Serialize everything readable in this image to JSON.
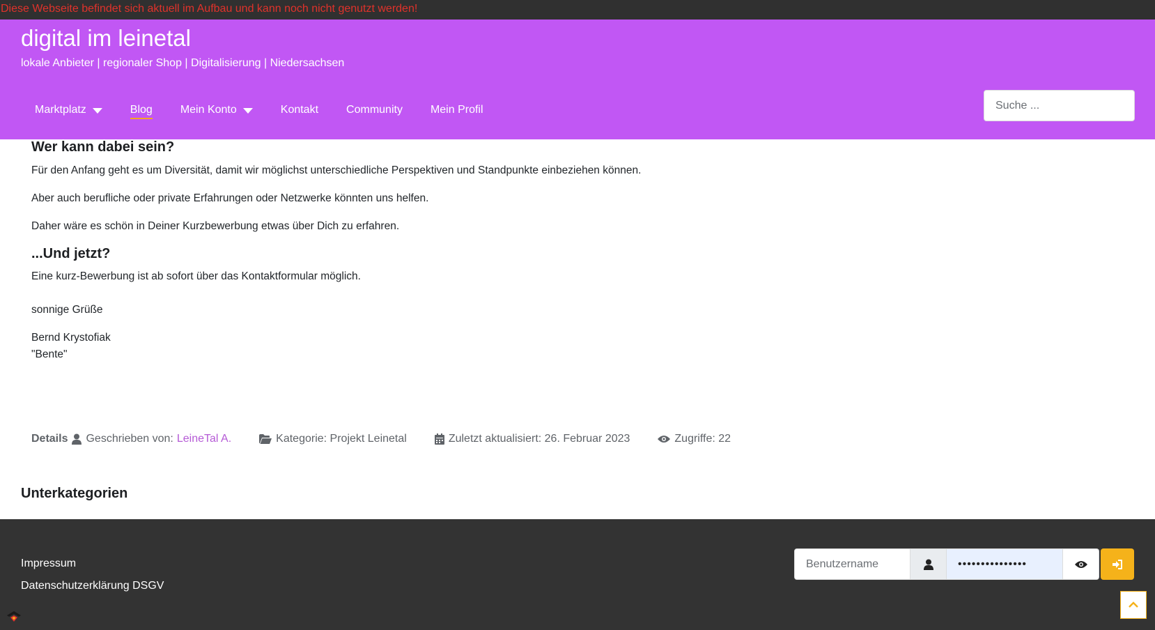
{
  "notice": "Diese Webseite befindet sich aktuell im Aufbau und kann noch nicht genutzt werden!",
  "site": {
    "title": "digital im leinetal",
    "tagline": "lokale Anbieter | regionaler Shop | Digitalisierung | Niedersachsen"
  },
  "nav": {
    "items": [
      {
        "label": "Marktplatz",
        "dropdown": true
      },
      {
        "label": "Blog",
        "active": true
      },
      {
        "label": "Mein Konto",
        "dropdown": true
      },
      {
        "label": "Kontakt"
      },
      {
        "label": "Community"
      },
      {
        "label": "Mein Profil"
      }
    ]
  },
  "search": {
    "placeholder": "Suche ..."
  },
  "article": {
    "heading1": "Wer kann dabei sein?",
    "p1": "Für den Anfang geht es um Diversität, damit wir möglichst unterschiedliche Perspektiven und Standpunkte einbeziehen können.",
    "p2": "Aber auch berufliche oder private Erfahrungen oder Netzwerke könnten uns helfen.",
    "p3": "Daher wäre es schön in Deiner Kurzbewerbung etwas über Dich zu erfahren.",
    "heading2": "...Und jetzt?",
    "p4": "Eine kurz-Bewerbung ist ab sofort über das Kontaktformular möglich.",
    "greeting": "sonnige Grüße",
    "author_name": "Bernd Krystofiak",
    "author_nick": "\"Bente\""
  },
  "details": {
    "label": "Details",
    "written_by": "Geschrieben von:",
    "author_link": "LeineTal A.",
    "category": "Kategorie: Projekt Leinetal",
    "updated": "Zuletzt aktualisiert: 26. Februar 2023",
    "hits": "Zugriffe: 22"
  },
  "subcategories": "Unterkategorien",
  "footer": {
    "impressum": "Impressum",
    "privacy": "Datenschutzerklärung DSGV"
  },
  "login": {
    "username_placeholder": "Benutzername",
    "password_value": "•••••••••••••••"
  },
  "colors": {
    "header_bg": "#c157f4",
    "notice_text": "#e0322b",
    "footer_bg": "#333333",
    "accent": "#f5b21a",
    "link": "#b55ad6"
  }
}
